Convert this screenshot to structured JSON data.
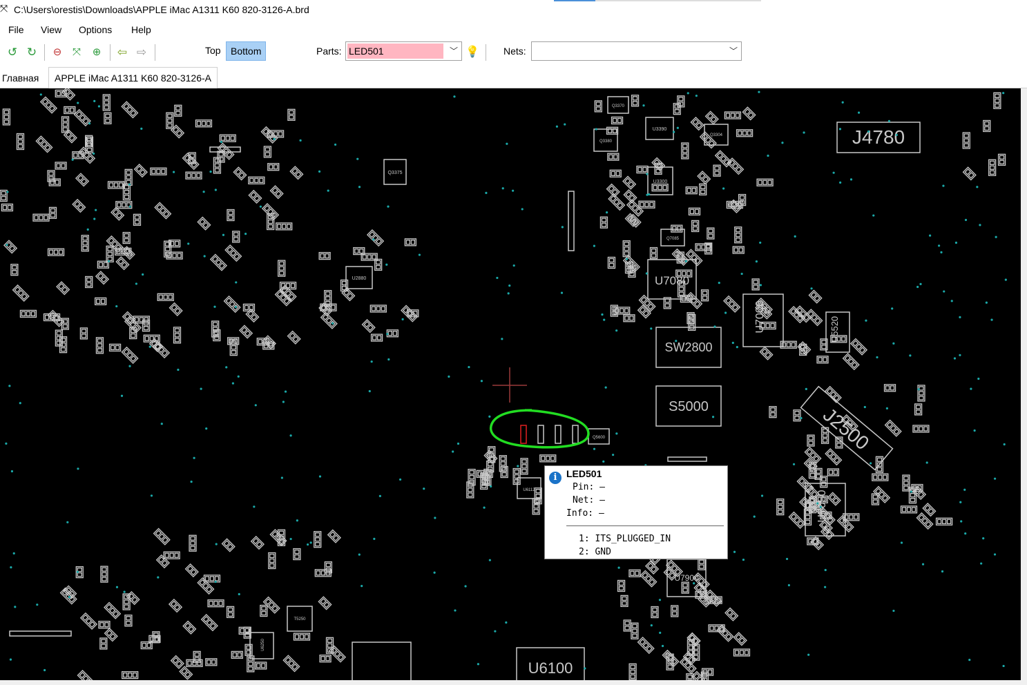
{
  "window": {
    "title": "C:\\Users\\orestis\\Downloads\\APPLE iMac A1311 K60 820-3126-A.brd",
    "app_icon": "app-icon"
  },
  "menu": [
    "File",
    "View",
    "Options",
    "Help"
  ],
  "toolbar": {
    "icons": [
      "rotate-ccw-icon",
      "rotate-cw-icon",
      "zoom-out-icon",
      "zoom-fit-icon",
      "zoom-in-icon",
      "back-arrow-icon",
      "forward-arrow-icon"
    ],
    "side_top": "Top",
    "side_bottom": "Bottom",
    "active_side": "Bottom",
    "parts_label": "Parts:",
    "parts_value": "LED501",
    "parts_highlight": "#ffb6c1",
    "nets_label": "Nets:",
    "nets_value": "",
    "bulb_icon": "bulb-icon"
  },
  "tabs": [
    {
      "label": "Главная",
      "active": false
    },
    {
      "label": "APPLE iMac A1311 K60 820-3126-A",
      "active": true
    }
  ],
  "board": {
    "background": "#000000",
    "outline_color": "#c8c8c8",
    "via_color": "#1aa8a8",
    "selected_color": "#e02020",
    "annotation_color": "#22dd22",
    "labels": [
      "J4780",
      "U7080",
      "SW2800",
      "S5000",
      "U7000",
      "U5520",
      "J2500",
      "U7050",
      "U6100",
      "U7900",
      "U2880",
      "Q3375",
      "Q3370",
      "U3390",
      "Q3304",
      "Q3380",
      "U3300",
      "Q7085",
      "Q5600",
      "U6112",
      "T5250",
      "U6250"
    ]
  },
  "tooltip": {
    "part": "LED501",
    "pin_line": "Pin: —",
    "net_line": "Net: —",
    "info_line": "Info: —",
    "pin1": "1: ITS_PLUGGED_IN",
    "pin2": "2: GND"
  }
}
